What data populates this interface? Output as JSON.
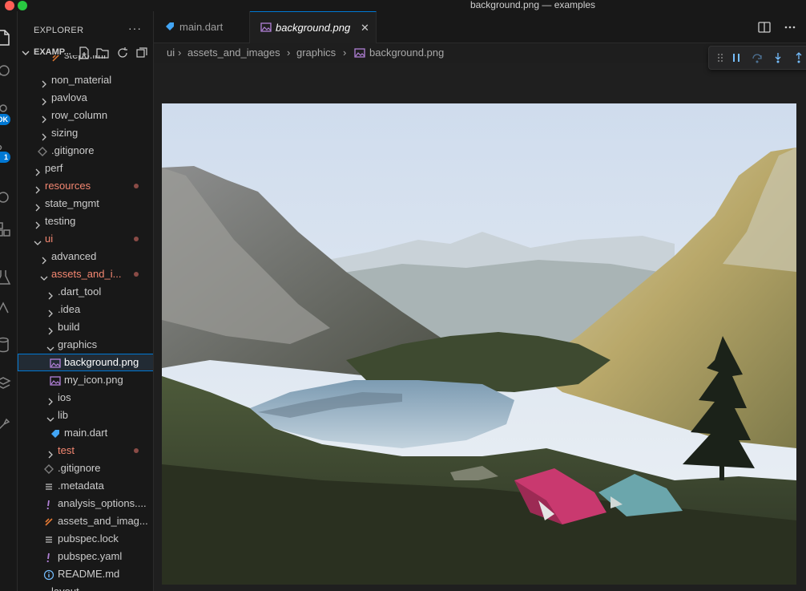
{
  "window": {
    "title": "background.png — examples"
  },
  "activity_bar": {
    "badges": {
      "accounts": "OK",
      "source_control": "1"
    }
  },
  "sidebar": {
    "title": "EXPLORER",
    "more": "···",
    "section_label": "EXAMP...",
    "partial_top_item": "step6.iml",
    "items": [
      {
        "label": "non_material"
      },
      {
        "label": "pavlova"
      },
      {
        "label": "row_column"
      },
      {
        "label": "sizing"
      },
      {
        "label": ".gitignore"
      },
      {
        "label": "perf"
      },
      {
        "label": "resources"
      },
      {
        "label": "state_mgmt"
      },
      {
        "label": "testing"
      },
      {
        "label": "ui"
      },
      {
        "label": "advanced"
      },
      {
        "label": "assets_and_i..."
      },
      {
        "label": ".dart_tool"
      },
      {
        "label": ".idea"
      },
      {
        "label": "build"
      },
      {
        "label": "graphics"
      },
      {
        "label": "background.png"
      },
      {
        "label": "my_icon.png"
      },
      {
        "label": "ios"
      },
      {
        "label": "lib"
      },
      {
        "label": "main.dart"
      },
      {
        "label": "test"
      },
      {
        "label": ".gitignore"
      },
      {
        "label": ".metadata"
      },
      {
        "label": "analysis_options...."
      },
      {
        "label": "assets_and_imag..."
      },
      {
        "label": "pubspec.lock"
      },
      {
        "label": "pubspec.yaml"
      },
      {
        "label": "README.md"
      },
      {
        "label": "layout"
      }
    ]
  },
  "tabs": [
    {
      "label": "main.dart"
    },
    {
      "label": "background.png",
      "close": "✕"
    }
  ],
  "breadcrumb": [
    "ui",
    "assets_and_images",
    "graphics",
    "background.png"
  ],
  "colors": {
    "accent": "#0078d4",
    "modified": "#f48771",
    "dart_icon": "#42a5f5",
    "image_icon": "#b180d7"
  }
}
